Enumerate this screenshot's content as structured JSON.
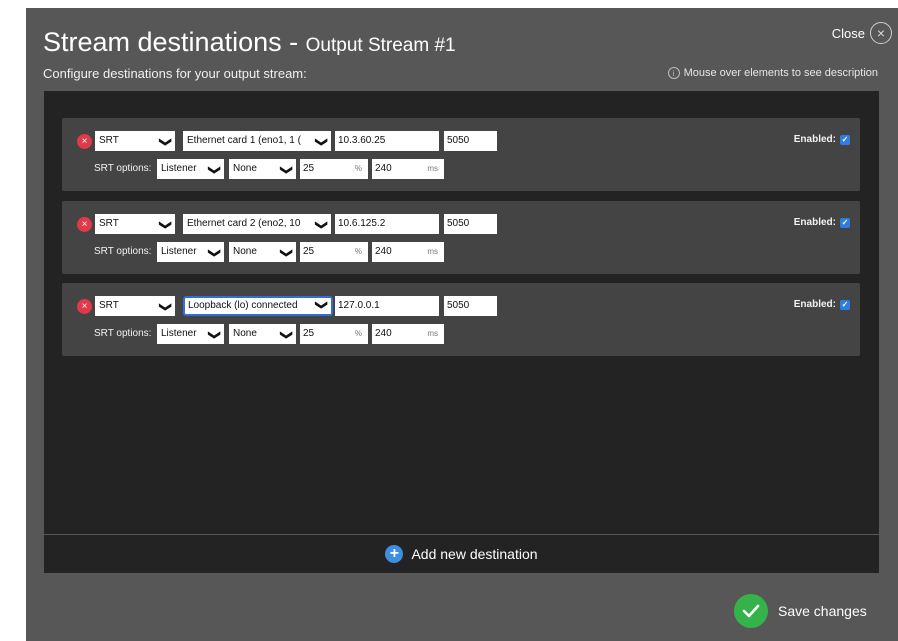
{
  "dialog": {
    "title": "Stream destinations",
    "title_separator": " - ",
    "stream_name": "Output Stream #1",
    "close_label": "Close",
    "close_glyph": "×",
    "subtitle": "Configure destinations for your output stream:",
    "hint": "Mouse over elements to see description",
    "hint_icon_glyph": "i",
    "add_destination_label": "Add new destination",
    "add_icon_glyph": "+",
    "save_label": "Save changes"
  },
  "colors": {
    "dialog_bg": "#575757",
    "panel_bg": "#232323",
    "destination_bg": "#444444",
    "remove_red": "#e0394a",
    "add_blue": "#3e8fe0",
    "save_green": "#35b34a",
    "focus_blue": "#2f6fd6",
    "checkbox_blue": "#2f7de1"
  },
  "labels": {
    "srt_options": "SRT options:",
    "enabled": "Enabled:",
    "percent_unit": "%",
    "ms_unit": "ms",
    "remove_glyph": "×",
    "check_glyph": "✓",
    "chevron_glyph": "❯"
  },
  "destinations": [
    {
      "protocol": "SRT",
      "interface": "Ethernet card 1 (eno1, 1 (",
      "ip": "10.3.60.25",
      "port": "5050",
      "srt_mode": "Listener",
      "encryption": "None",
      "overhead_percent": "25",
      "latency_ms": "240",
      "enabled": true
    },
    {
      "protocol": "SRT",
      "interface": "Ethernet card 2 (eno2, 10",
      "ip": "10.6.125.2",
      "port": "5050",
      "srt_mode": "Listener",
      "encryption": "None",
      "overhead_percent": "25",
      "latency_ms": "240",
      "enabled": true
    },
    {
      "protocol": "SRT",
      "interface": "Loopback (lo) connected",
      "ip": "127.0.0.1",
      "port": "5050",
      "srt_mode": "Listener",
      "encryption": "None",
      "overhead_percent": "25",
      "latency_ms": "240",
      "enabled": true
    }
  ]
}
